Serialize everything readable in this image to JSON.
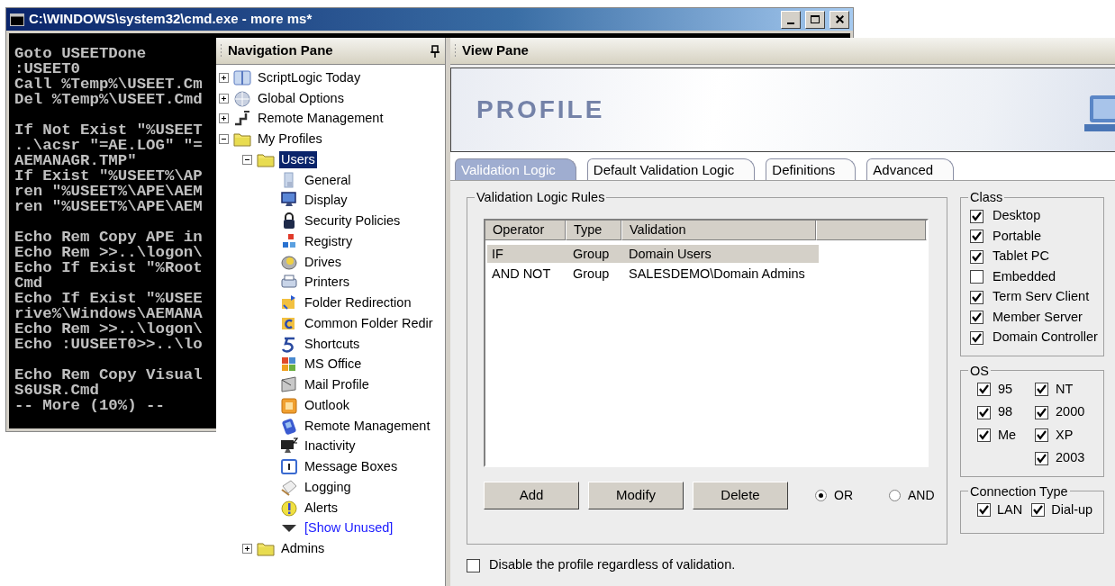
{
  "console_window": {
    "title": "C:\\WINDOWS\\system32\\cmd.exe - more ms*",
    "blocks": [
      [
        "Goto USEETDone",
        ":USEET0",
        "Call %Temp%\\USEET.Cm",
        "Del %Temp%\\USEET.Cmd"
      ],
      [
        "If Not Exist \"%USEET",
        "..\\acsr \"=AE.LOG\" \"=",
        "AEMANAGR.TMP\"",
        "If Exist \"%USEET%\\AP",
        "ren \"%USEET%\\APE\\AEM",
        "ren \"%USEET%\\APE\\AEM"
      ],
      [
        "Echo Rem Copy APE in",
        "Echo Rem >>..\\logon\\",
        "Echo If Exist \"%Root",
        "Cmd",
        "Echo If Exist \"%USEE",
        "rive%\\Windows\\AEMANA",
        "Echo Rem >>..\\logon\\",
        "Echo :UUSEET0>>..\\lo"
      ],
      [
        "Echo Rem Copy Visual",
        "S6USR.Cmd",
        "-- More (10%) --"
      ]
    ]
  },
  "navigation_pane": {
    "title": "Navigation Pane",
    "tree": [
      {
        "label": "ScriptLogic Today",
        "kind": "node",
        "expanded": false,
        "selected": false
      },
      {
        "label": "Global Options",
        "kind": "node",
        "expanded": false,
        "selected": false
      },
      {
        "label": "Remote Management",
        "kind": "node",
        "expanded": false,
        "selected": false
      },
      {
        "label": "My Profiles",
        "kind": "folder",
        "expanded": true,
        "selected": false,
        "children": [
          {
            "label": "Users",
            "kind": "folder",
            "expanded": true,
            "selected": true,
            "children": [
              {
                "label": "General",
                "kind": "leaf",
                "selected": false
              },
              {
                "label": "Display",
                "kind": "leaf",
                "selected": false
              },
              {
                "label": "Security Policies",
                "kind": "leaf",
                "selected": false
              },
              {
                "label": "Registry",
                "kind": "leaf",
                "selected": false
              },
              {
                "label": "Drives",
                "kind": "leaf",
                "selected": false
              },
              {
                "label": "Printers",
                "kind": "leaf",
                "selected": false
              },
              {
                "label": "Folder Redirection",
                "kind": "leaf",
                "selected": false
              },
              {
                "label": "Common Folder Redir",
                "kind": "leaf",
                "selected": false
              },
              {
                "label": "Shortcuts",
                "kind": "leaf",
                "selected": false
              },
              {
                "label": "MS Office",
                "kind": "leaf",
                "selected": false
              },
              {
                "label": "Mail Profile",
                "kind": "leaf",
                "selected": false
              },
              {
                "label": "Outlook",
                "kind": "leaf",
                "selected": false
              },
              {
                "label": "Remote Management",
                "kind": "leaf",
                "selected": false
              },
              {
                "label": "Inactivity",
                "kind": "leaf",
                "selected": false
              },
              {
                "label": "Message Boxes",
                "kind": "leaf",
                "selected": false
              },
              {
                "label": "Logging",
                "kind": "leaf",
                "selected": false
              },
              {
                "label": "Alerts",
                "kind": "leaf",
                "selected": false
              },
              {
                "label": "[Show Unused]",
                "kind": "link",
                "selected": false
              }
            ]
          },
          {
            "label": "Admins",
            "kind": "folder",
            "expanded": false,
            "selected": false
          }
        ]
      }
    ]
  },
  "view_pane": {
    "title": "View Pane",
    "banner_title": "PROFILE",
    "tabs": [
      {
        "label": "Validation Logic",
        "selected": true
      },
      {
        "label": "Default Validation Logic",
        "selected": false
      },
      {
        "label": "Definitions",
        "selected": false
      },
      {
        "label": "Advanced",
        "selected": false
      }
    ],
    "rules": {
      "title": "Validation Logic Rules",
      "columns": [
        "Operator",
        "Type",
        "Validation"
      ],
      "rows": [
        {
          "cells": [
            "IF",
            "Group",
            "Domain Users"
          ],
          "selected": true
        },
        {
          "cells": [
            "AND NOT",
            "Group",
            "SALESDEMO\\Domain Admins"
          ],
          "selected": false
        }
      ],
      "buttons": [
        "Add",
        "Modify",
        "Delete"
      ],
      "radios": [
        {
          "label": "OR",
          "selected": true
        },
        {
          "label": "AND",
          "selected": false
        }
      ]
    },
    "disable_option": {
      "label": "Disable the profile regardless of validation.",
      "checked": false
    },
    "class_group": {
      "title": "Class",
      "items": [
        {
          "label": "Desktop",
          "checked": true
        },
        {
          "label": "Portable",
          "checked": true
        },
        {
          "label": "Tablet PC",
          "checked": true
        },
        {
          "label": "Embedded",
          "checked": false
        },
        {
          "label": "Term Serv Client",
          "checked": true
        },
        {
          "label": "Member Server",
          "checked": true
        },
        {
          "label": "Domain Controller",
          "checked": true
        }
      ]
    },
    "os_group": {
      "title": "OS",
      "columns": [
        [
          {
            "label": "95",
            "checked": true
          },
          {
            "label": "98",
            "checked": true
          },
          {
            "label": "Me",
            "checked": true
          }
        ],
        [
          {
            "label": "NT",
            "checked": true
          },
          {
            "label": "2000",
            "checked": true
          },
          {
            "label": "XP",
            "checked": true
          },
          {
            "label": "2003",
            "checked": true
          }
        ]
      ]
    },
    "connection_group": {
      "title": "Connection Type",
      "items": [
        {
          "label": "LAN",
          "checked": true
        },
        {
          "label": "Dial-up",
          "checked": true
        }
      ]
    }
  }
}
